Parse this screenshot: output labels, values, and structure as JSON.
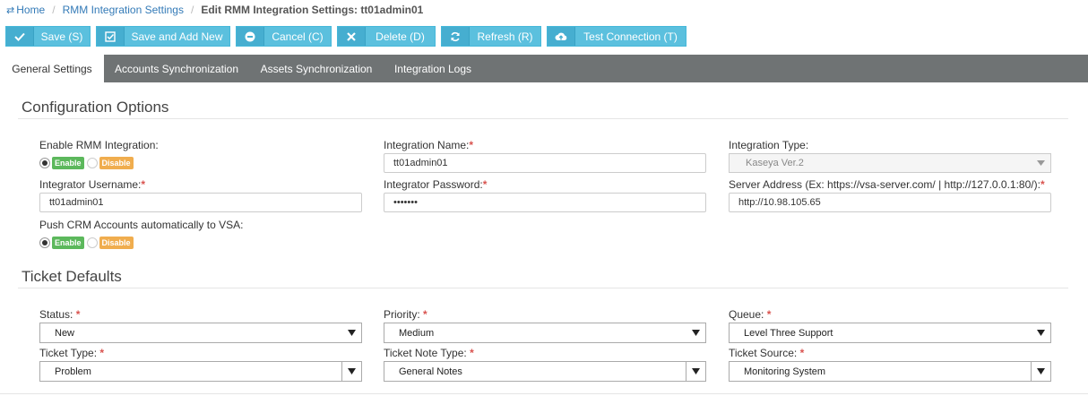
{
  "breadcrumb": {
    "home": "Home",
    "parent": "RMM Integration Settings",
    "current": "Edit RMM Integration Settings: tt01admin01"
  },
  "toolbar": {
    "save": "Save (S)",
    "save_add_new": "Save and Add New",
    "cancel": "Cancel (C)",
    "delete": "Delete (D)",
    "refresh": "Refresh (R)",
    "test_connection": "Test Connection (T)"
  },
  "tabs": [
    "General Settings",
    "Accounts Synchronization",
    "Assets Synchronization",
    "Integration Logs"
  ],
  "config": {
    "title": "Configuration Options",
    "enable_label": "Enable RMM Integration:",
    "enable_on": "Enable",
    "enable_off": "Disable",
    "name_label": "Integration Name:",
    "name_value": "tt01admin01",
    "type_label": "Integration Type:",
    "type_value": "Kaseya Ver.2",
    "username_label": "Integrator Username:",
    "username_value": "tt01admin01",
    "password_label": "Integrator Password:",
    "password_value": "•••••••",
    "server_label": "Server Address (Ex: https://vsa-server.com/ | http://127.0.0.1:80/):",
    "server_value": "http://10.98.105.65",
    "push_label": "Push CRM Accounts automatically to VSA:",
    "push_on": "Enable",
    "push_off": "Disable"
  },
  "ticket": {
    "title": "Ticket Defaults",
    "status_label": "Status:",
    "status_value": "New",
    "priority_label": "Priority:",
    "priority_value": "Medium",
    "queue_label": "Queue:",
    "queue_value": "Level Three Support",
    "type_label": "Ticket Type:",
    "type_value": "Problem",
    "note_type_label": "Ticket Note Type:",
    "note_type_value": "General Notes",
    "source_label": "Ticket Source:",
    "source_value": "Monitoring System"
  },
  "required_mark": "*",
  "colors": {
    "button": "#5bc0de",
    "tab_bar": "#6f7374",
    "enable_badge": "#5cb85c",
    "disable_badge": "#f0ad4e",
    "required": "#d9534f"
  }
}
